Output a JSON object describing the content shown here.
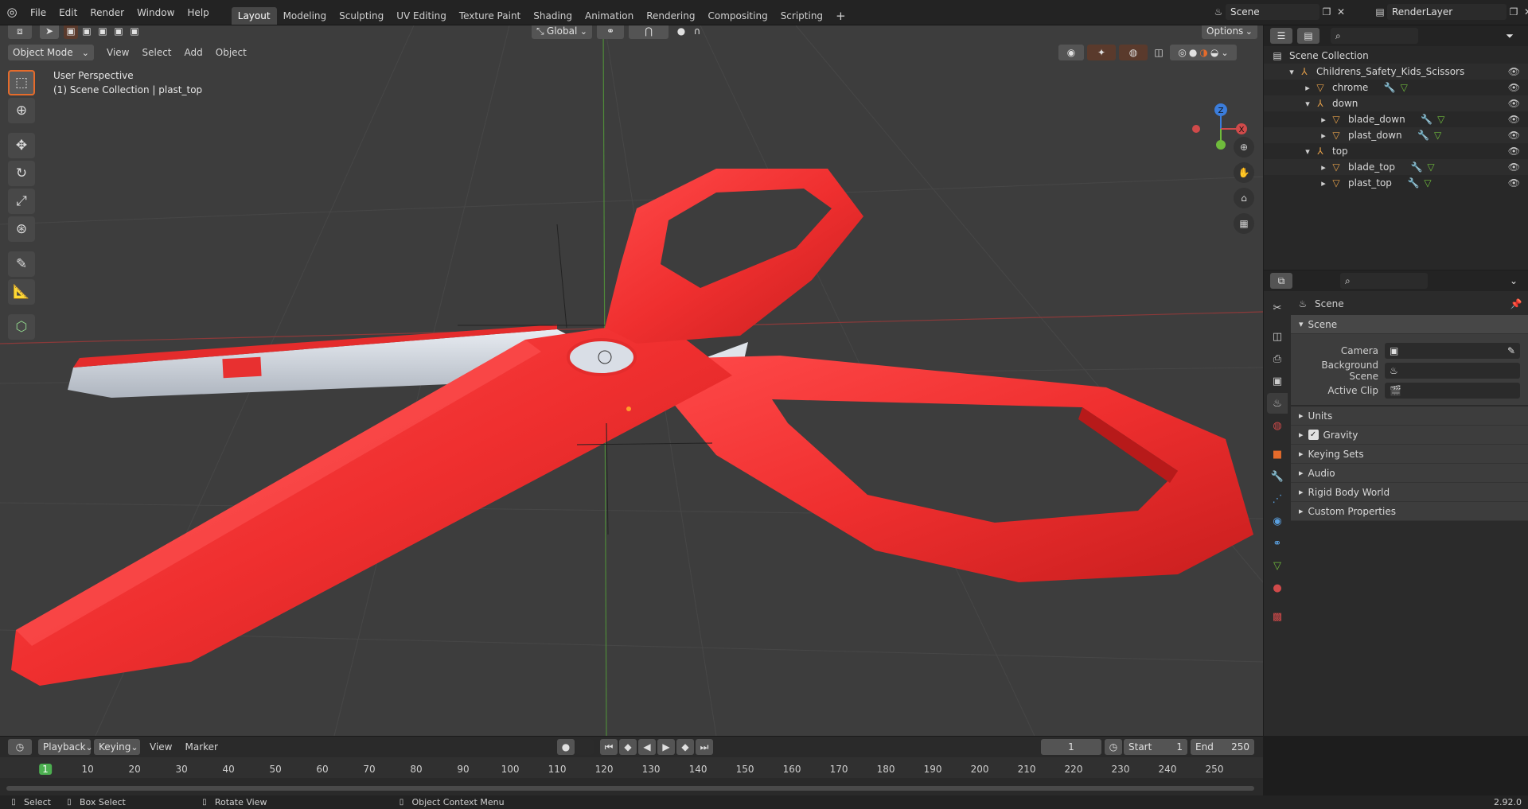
{
  "topbar": {
    "menus": [
      "File",
      "Edit",
      "Render",
      "Window",
      "Help"
    ],
    "workspaces": [
      "Layout",
      "Modeling",
      "Sculpting",
      "UV Editing",
      "Texture Paint",
      "Shading",
      "Animation",
      "Rendering",
      "Compositing",
      "Scripting"
    ],
    "active_workspace": "Layout",
    "add_tab": "+",
    "scene_name": "Scene",
    "render_layer": "RenderLayer"
  },
  "viewport": {
    "mode": "Object Mode",
    "menus": [
      "View",
      "Select",
      "Add",
      "Object"
    ],
    "orientation": "Global",
    "options_label": "Options",
    "info_line1": "User Perspective",
    "info_line2": "(1) Scene Collection | plast_top",
    "gizmo_x": "X",
    "gizmo_z": "Z"
  },
  "outliner": {
    "rows": [
      {
        "label": "Scene Collection",
        "indent": 0
      },
      {
        "label": "Childrens_Safety_Kids_Scissors",
        "indent": 1
      },
      {
        "label": "chrome",
        "indent": 2
      },
      {
        "label": "down",
        "indent": 2
      },
      {
        "label": "blade_down",
        "indent": 3
      },
      {
        "label": "plast_down",
        "indent": 3
      },
      {
        "label": "top",
        "indent": 2
      },
      {
        "label": "blade_top",
        "indent": 3
      },
      {
        "label": "plast_top",
        "indent": 3
      }
    ]
  },
  "properties": {
    "context": "Scene",
    "section": "Scene",
    "fields": [
      {
        "label": "Camera"
      },
      {
        "label": "Background Scene"
      },
      {
        "label": "Active Clip"
      }
    ],
    "panels": [
      "Units",
      "Gravity",
      "Keying Sets",
      "Audio",
      "Rigid Body World",
      "Custom Properties"
    ]
  },
  "timeline": {
    "menus": [
      "Playback",
      "Keying",
      "View",
      "Marker"
    ],
    "current_frame": "1",
    "start_label": "Start",
    "start_value": "1",
    "end_label": "End",
    "end_value": "250",
    "ticks": [
      "1",
      "10",
      "20",
      "30",
      "40",
      "50",
      "60",
      "70",
      "80",
      "90",
      "100",
      "110",
      "120",
      "130",
      "140",
      "150",
      "160",
      "170",
      "180",
      "190",
      "200",
      "210",
      "220",
      "230",
      "240",
      "250"
    ]
  },
  "statusbar": {
    "select": "Select",
    "box_select": "Box Select",
    "rotate_view": "Rotate View",
    "context_menu": "Object Context Menu",
    "version": "2.92.0"
  },
  "colors": {
    "accent": "#e56b2b",
    "active_frame": "#4caf50",
    "axis_x": "#d04a4a",
    "axis_y": "#6fbb3c",
    "axis_z": "#3b7ddb"
  }
}
